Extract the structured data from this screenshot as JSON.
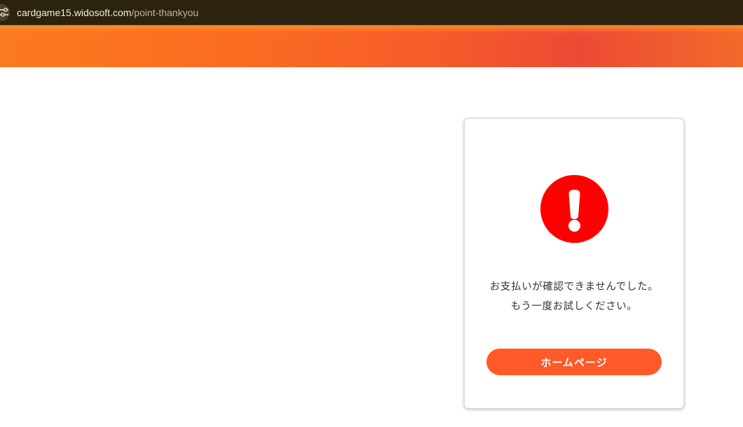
{
  "browser": {
    "url_host": "cardgame15.widosoft.com",
    "url_path": "/point-thankyou",
    "site_icon": "tune-icon"
  },
  "colors": {
    "banner_orange": "#fb7a1e",
    "banner_red": "#ec4a35",
    "alert_red": "#ff0000",
    "button_orange": "#ff5a28"
  },
  "card": {
    "icon": "exclamation-circle-icon",
    "message_line1": "お支払いが確認できませんでした。",
    "message_line2": "もう一度お試しください。",
    "button_label": "ホームページ"
  }
}
